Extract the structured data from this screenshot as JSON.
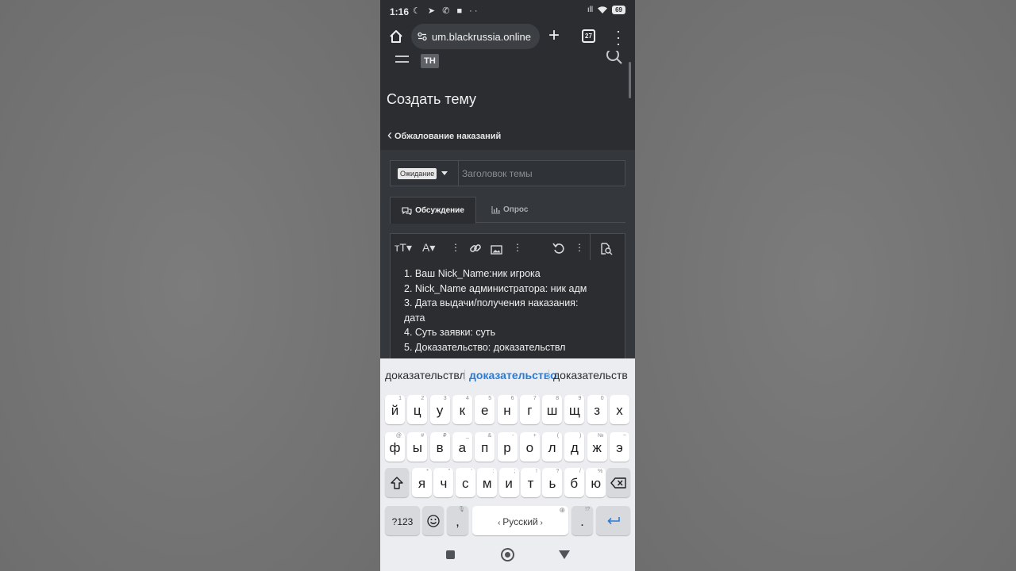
{
  "status_bar": {
    "time": "1:16",
    "left_icons": "☾ ➤ ✆ ■ ··",
    "signal": "ıll",
    "battery": "69"
  },
  "browser": {
    "url": "um.blackrussia.online",
    "tab_count": "27"
  },
  "site": {
    "logo_text": "ТН"
  },
  "page": {
    "title": "Создать тему",
    "breadcrumb": "Обжалование наказаний"
  },
  "form": {
    "prefix": "Ожидание",
    "title_placeholder": "Заголовок темы",
    "tabs": [
      {
        "label": "Обсуждение",
        "active": true
      },
      {
        "label": "Опрос",
        "active": false
      }
    ]
  },
  "editor": {
    "lines": [
      "1. Ваш Nick_Name:ник игрока",
      "2. Nick_Name администратора: ник адм",
      "3. Дата выдачи/получения наказания:",
      "дата",
      "4. Суть заявки: суть",
      "5. Доказательство: доказательствл"
    ]
  },
  "keyboard": {
    "suggestions": [
      "доказательствл",
      "доказательство",
      "доказательств"
    ],
    "row1": [
      {
        "k": "й",
        "h": "1"
      },
      {
        "k": "ц",
        "h": "2"
      },
      {
        "k": "у",
        "h": "3"
      },
      {
        "k": "к",
        "h": "4"
      },
      {
        "k": "е",
        "h": "5"
      },
      {
        "k": "н",
        "h": "6"
      },
      {
        "k": "г",
        "h": "7"
      },
      {
        "k": "ш",
        "h": "8"
      },
      {
        "k": "щ",
        "h": "9"
      },
      {
        "k": "з",
        "h": "0"
      },
      {
        "k": "х",
        "h": ""
      }
    ],
    "row2": [
      {
        "k": "ф",
        "h": "@"
      },
      {
        "k": "ы",
        "h": "#"
      },
      {
        "k": "в",
        "h": "₽"
      },
      {
        "k": "а",
        "h": "_"
      },
      {
        "k": "п",
        "h": "&"
      },
      {
        "k": "р",
        "h": "-"
      },
      {
        "k": "о",
        "h": "+"
      },
      {
        "k": "л",
        "h": "("
      },
      {
        "k": "д",
        "h": ")"
      },
      {
        "k": "ж",
        "h": "№"
      },
      {
        "k": "э",
        "h": "~"
      }
    ],
    "row3": [
      {
        "k": "я",
        "h": "*"
      },
      {
        "k": "ч",
        "h": "\""
      },
      {
        "k": "с",
        "h": "'"
      },
      {
        "k": "м",
        "h": ":"
      },
      {
        "k": "и",
        "h": ";"
      },
      {
        "k": "т",
        "h": "!"
      },
      {
        "k": "ь",
        "h": "?"
      },
      {
        "k": "б",
        "h": "/"
      },
      {
        "k": "ю",
        "h": "%"
      }
    ],
    "numbers_label": "?123",
    "comma": ",",
    "space_label": "Русский",
    "period": ".",
    "period_hint": "!?"
  }
}
